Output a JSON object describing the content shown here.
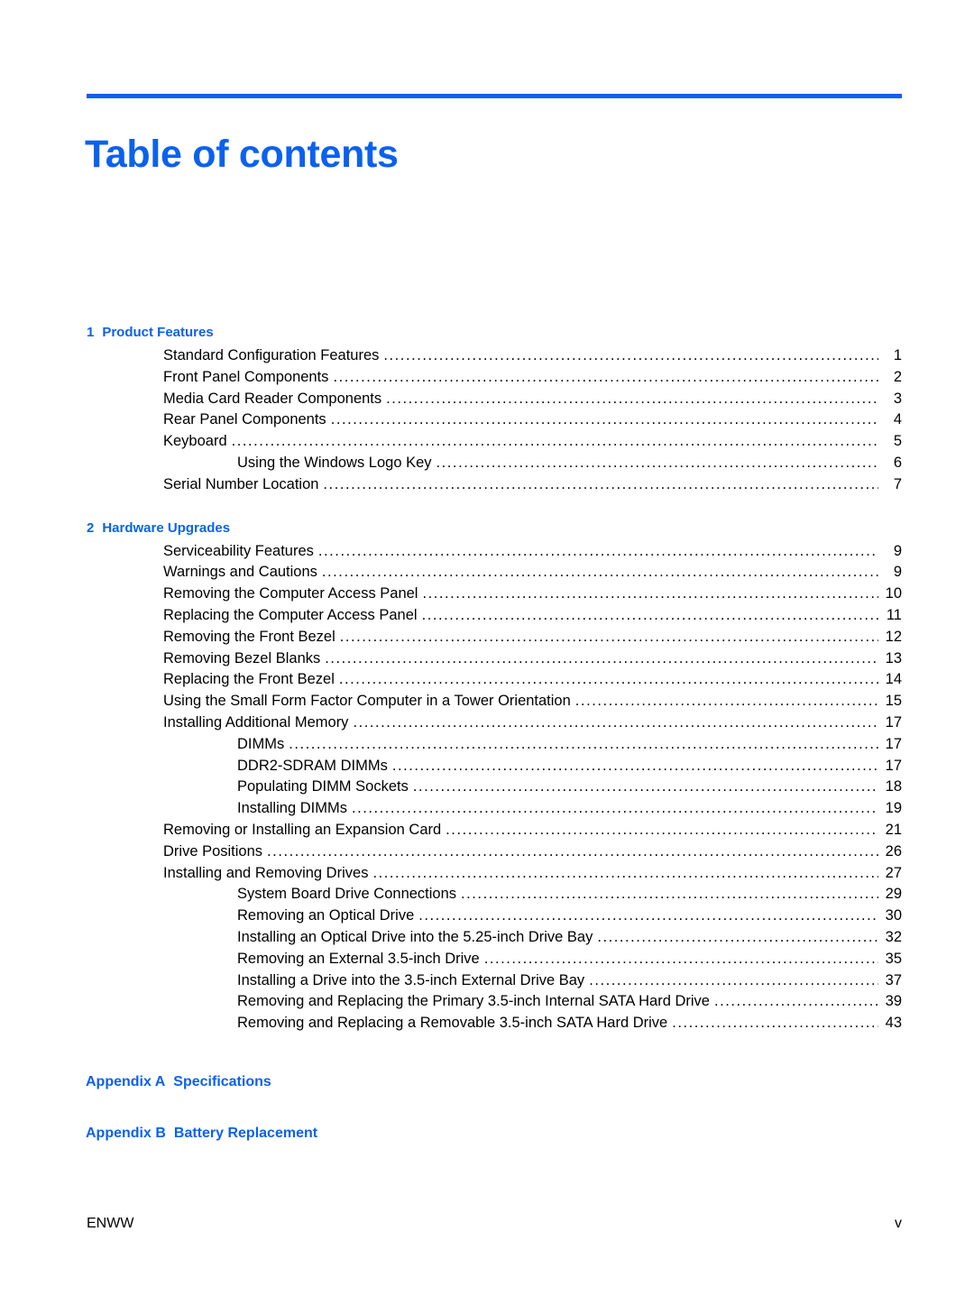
{
  "document": {
    "title": "Table of contents",
    "accent_color": "#0b61ee",
    "text_color": "#000000",
    "background_color": "#ffffff"
  },
  "footer": {
    "left": "ENWW",
    "right": "v"
  },
  "toc": {
    "chapters": [
      {
        "number": "1",
        "name": "Product Features",
        "entries": [
          {
            "level": 1,
            "title": "Standard Configuration Features",
            "page": "1"
          },
          {
            "level": 1,
            "title": "Front Panel Components",
            "page": "2"
          },
          {
            "level": 1,
            "title": "Media Card Reader Components",
            "page": "3"
          },
          {
            "level": 1,
            "title": "Rear Panel Components",
            "page": "4"
          },
          {
            "level": 1,
            "title": "Keyboard",
            "page": "5"
          },
          {
            "level": 2,
            "title": "Using the Windows Logo Key",
            "page": "6"
          },
          {
            "level": 1,
            "title": "Serial Number Location",
            "page": "7"
          }
        ]
      },
      {
        "number": "2",
        "name": "Hardware Upgrades",
        "entries": [
          {
            "level": 1,
            "title": "Serviceability Features",
            "page": "9"
          },
          {
            "level": 1,
            "title": "Warnings and Cautions",
            "page": "9"
          },
          {
            "level": 1,
            "title": "Removing the Computer Access Panel",
            "page": "10"
          },
          {
            "level": 1,
            "title": "Replacing the Computer Access Panel",
            "page": "11"
          },
          {
            "level": 1,
            "title": "Removing the Front Bezel",
            "page": "12"
          },
          {
            "level": 1,
            "title": "Removing Bezel Blanks",
            "page": "13"
          },
          {
            "level": 1,
            "title": "Replacing the Front Bezel",
            "page": "14"
          },
          {
            "level": 1,
            "title": "Using the Small Form Factor Computer in a Tower Orientation",
            "page": "15"
          },
          {
            "level": 1,
            "title": "Installing Additional Memory",
            "page": "17"
          },
          {
            "level": 2,
            "title": "DIMMs",
            "page": "17"
          },
          {
            "level": 2,
            "title": "DDR2-SDRAM DIMMs",
            "page": "17"
          },
          {
            "level": 2,
            "title": "Populating DIMM Sockets",
            "page": "18"
          },
          {
            "level": 2,
            "title": "Installing DIMMs",
            "page": "19"
          },
          {
            "level": 1,
            "title": "Removing or Installing an Expansion Card",
            "page": "21"
          },
          {
            "level": 1,
            "title": "Drive Positions",
            "page": "26"
          },
          {
            "level": 1,
            "title": "Installing and Removing Drives",
            "page": "27"
          },
          {
            "level": 2,
            "title": "System Board Drive Connections",
            "page": "29"
          },
          {
            "level": 2,
            "title": "Removing an Optical Drive",
            "page": "30"
          },
          {
            "level": 2,
            "title": "Installing an Optical Drive into the 5.25-inch Drive Bay",
            "page": "32"
          },
          {
            "level": 2,
            "title": "Removing an External 3.5-inch Drive",
            "page": "35"
          },
          {
            "level": 2,
            "title": "Installing a Drive into the 3.5-inch External Drive Bay",
            "page": "37"
          },
          {
            "level": 2,
            "title": "Removing and Replacing the Primary 3.5-inch Internal SATA Hard Drive",
            "page": "39"
          },
          {
            "level": 2,
            "title": "Removing and Replacing a Removable 3.5-inch SATA Hard Drive",
            "page": "43"
          }
        ]
      }
    ],
    "appendices": [
      {
        "label": "Appendix A",
        "name": "Specifications"
      },
      {
        "label": "Appendix B",
        "name": "Battery Replacement"
      }
    ]
  }
}
